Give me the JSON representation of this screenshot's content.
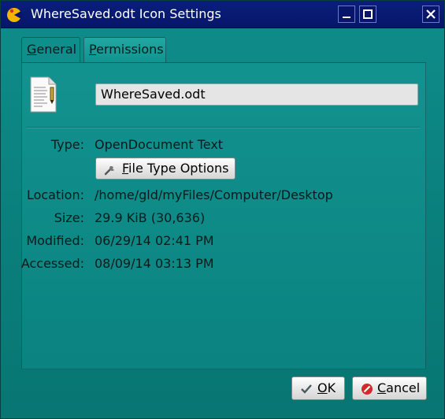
{
  "window": {
    "title": "WhereSaved.odt Icon Settings",
    "controls": [
      "minimize-icon",
      "maximize-icon",
      "close-icon"
    ]
  },
  "tabs": [
    {
      "label": "General",
      "mnemonic": "G",
      "rest": "eneral",
      "active": true
    },
    {
      "label": "Permissions",
      "mnemonic": "P",
      "rest": "ermissions",
      "active": false
    }
  ],
  "general": {
    "name_value": "WhereSaved.odt",
    "type_label": "Type:",
    "type_value": "OpenDocument Text",
    "file_type_button": {
      "mnemonic": "F",
      "rest": "ile Type Options",
      "icon": "wrench-icon"
    },
    "location_label": "Location:",
    "location_value": "/home/gld/myFiles/Computer/Desktop",
    "size_label": "Size:",
    "size_value": "29.9 KiB (30,636)",
    "modified_label": "Modified:",
    "modified_value": "06/29/14 02:41 PM",
    "accessed_label": "Accessed:",
    "accessed_value": "08/09/14 03:13 PM"
  },
  "buttons": {
    "ok": {
      "mnemonic": "O",
      "rest": "K",
      "icon": "checkmark-icon"
    },
    "cancel": {
      "mnemonic": "C",
      "rest": "ancel",
      "icon": "cancel-icon"
    }
  }
}
